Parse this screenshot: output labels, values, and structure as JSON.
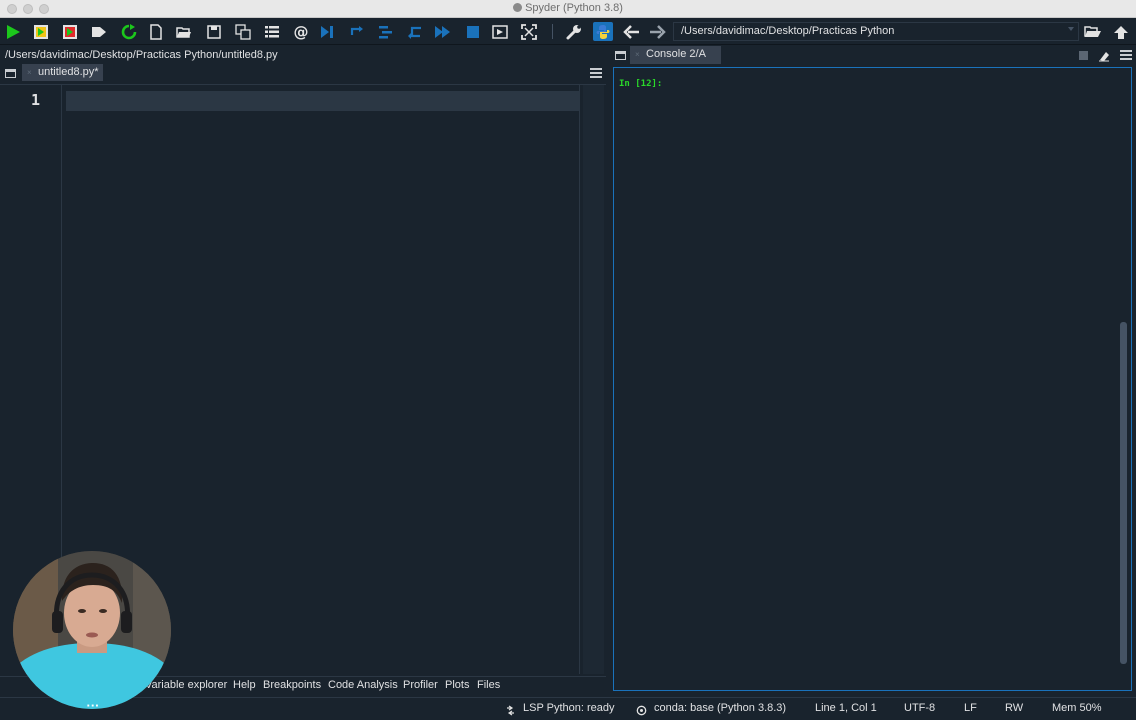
{
  "window": {
    "title": "Spyder (Python 3.8)"
  },
  "toolbar": {
    "working_dir": "/Users/davidimac/Desktop/Practicas Python",
    "icons": [
      "run-icon",
      "run-cell-icon",
      "run-cell-advance-icon",
      "run-selection-icon",
      "rerun-icon",
      "new-file-icon",
      "open-file-icon",
      "save-icon",
      "save-all-icon",
      "outline-icon",
      "at-icon",
      "debug-icon",
      "step-icon",
      "step-into-icon",
      "step-return-icon",
      "continue-icon",
      "stop-icon",
      "maximize-pane-icon",
      "fullscreen-icon",
      "wrench-icon",
      "python-path-icon",
      "back-arrow-icon",
      "forward-arrow-icon",
      "browse-folder-icon",
      "parent-dir-icon"
    ]
  },
  "editor": {
    "file_path": "/Users/davidimac/Desktop/Practicas Python/untitled8.py",
    "tab_label": "untitled8.py*",
    "tab_close": "×",
    "line_numbers": [
      "1"
    ]
  },
  "bottom_tabs": [
    "Variable explorer",
    "Help",
    "Breakpoints",
    "Code Analysis",
    "Profiler",
    "Plots",
    "Files"
  ],
  "console": {
    "tab_label": "Console 2/A",
    "tab_close": "×",
    "prompt": "In [12]:"
  },
  "status": {
    "lsp": "LSP Python: ready",
    "conda": "conda: base (Python 3.8.3)",
    "position": "Line 1, Col 1",
    "encoding": "UTF-8",
    "eol": "LF",
    "permissions": "RW",
    "memory": "Mem 50%"
  },
  "overlay": {
    "more_label": "···"
  },
  "colors": {
    "background": "#19232d",
    "accent": "#1a72bb",
    "prompt": "#2ad82a",
    "tab": "#37414f"
  }
}
